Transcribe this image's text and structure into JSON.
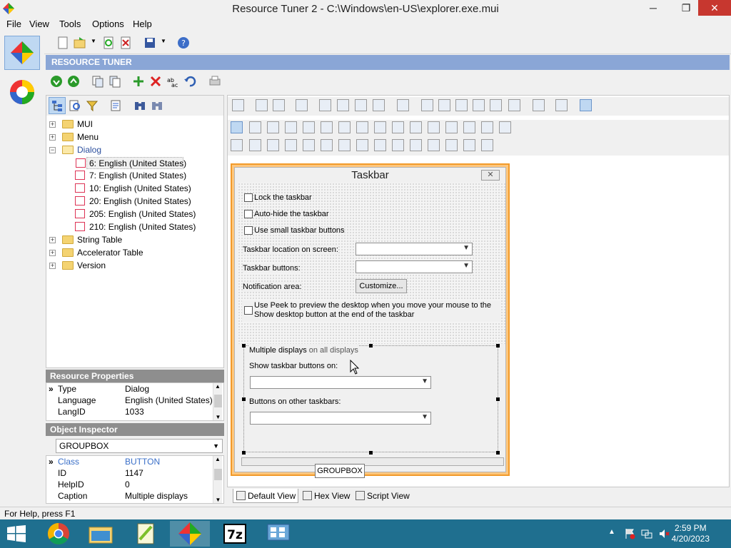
{
  "window": {
    "title": "Resource Tuner 2 - C:\\Windows\\en-US\\explorer.exe.mui",
    "minimize": "─",
    "maximize": "❐",
    "close": "✕"
  },
  "menu": [
    "File",
    "View",
    "Tools",
    "Options",
    "Help"
  ],
  "header": "RESOURCE TUNER",
  "tree": {
    "items": [
      {
        "label": "MUI",
        "type": "folder",
        "expander": "+",
        "level": 0
      },
      {
        "label": "Menu",
        "type": "folder",
        "expander": "+",
        "level": 0
      },
      {
        "label": "Dialog",
        "type": "folder",
        "expander": "−",
        "level": 0
      },
      {
        "label": "6: English (United States)",
        "type": "dialog",
        "level": 1,
        "selected": true
      },
      {
        "label": "7: English (United States)",
        "type": "dialog",
        "level": 1
      },
      {
        "label": "10: English (United States)",
        "type": "dialog",
        "level": 1
      },
      {
        "label": "20: English (United States)",
        "type": "dialog",
        "level": 1
      },
      {
        "label": "205: English (United States)",
        "type": "dialog",
        "level": 1
      },
      {
        "label": "210: English (United States)",
        "type": "dialog",
        "level": 1
      },
      {
        "label": "String Table",
        "type": "folder",
        "expander": "+",
        "level": 0
      },
      {
        "label": "Accelerator Table",
        "type": "folder",
        "expander": "+",
        "level": 0
      },
      {
        "label": "Version",
        "type": "folder",
        "expander": "+",
        "level": 0
      }
    ]
  },
  "resource_properties": {
    "title": "Resource Properties",
    "rows": [
      {
        "key": "Type",
        "value": "Dialog"
      },
      {
        "key": "Language",
        "value": "English (United States)"
      },
      {
        "key": "LangID",
        "value": "1033"
      }
    ]
  },
  "object_inspector": {
    "title": "Object Inspector",
    "selected": "GROUPBOX",
    "rows": [
      {
        "key": "Class",
        "value": "BUTTON"
      },
      {
        "key": "ID",
        "value": "1147"
      },
      {
        "key": "HelpID",
        "value": "0"
      },
      {
        "key": "Caption",
        "value": "Multiple displays"
      }
    ]
  },
  "dialog": {
    "title": "Taskbar",
    "close": "✕",
    "checkboxes": [
      "Lock the taskbar",
      "Auto-hide the taskbar",
      "Use small taskbar buttons"
    ],
    "location_label": "Taskbar location on screen:",
    "buttons_label": "Taskbar buttons:",
    "notification_label": "Notification area:",
    "customize_button": "Customize...",
    "peek_text_1": "Use Peek to preview the desktop when you move your mouse to the",
    "peek_text_2": "Show desktop button at the end of the taskbar",
    "group_title": "Multiple displays",
    "group_title_overlap": "on all displays",
    "show_buttons_on": "Show taskbar buttons on:",
    "buttons_other": "Buttons on other taskbars:",
    "tooltip": "GROUPBOX"
  },
  "view_tabs": [
    {
      "label": "Default View",
      "selected": true
    },
    {
      "label": "Hex View"
    },
    {
      "label": "Script View"
    }
  ],
  "status": "For Help, press F1",
  "clock": {
    "time": "2:59 PM",
    "date": "4/20/2023"
  },
  "colors": {
    "header_bg": "#8aa6d6",
    "taskbar_bg": "#1f6f8f",
    "dialog_highlight": "#f19a2a"
  }
}
